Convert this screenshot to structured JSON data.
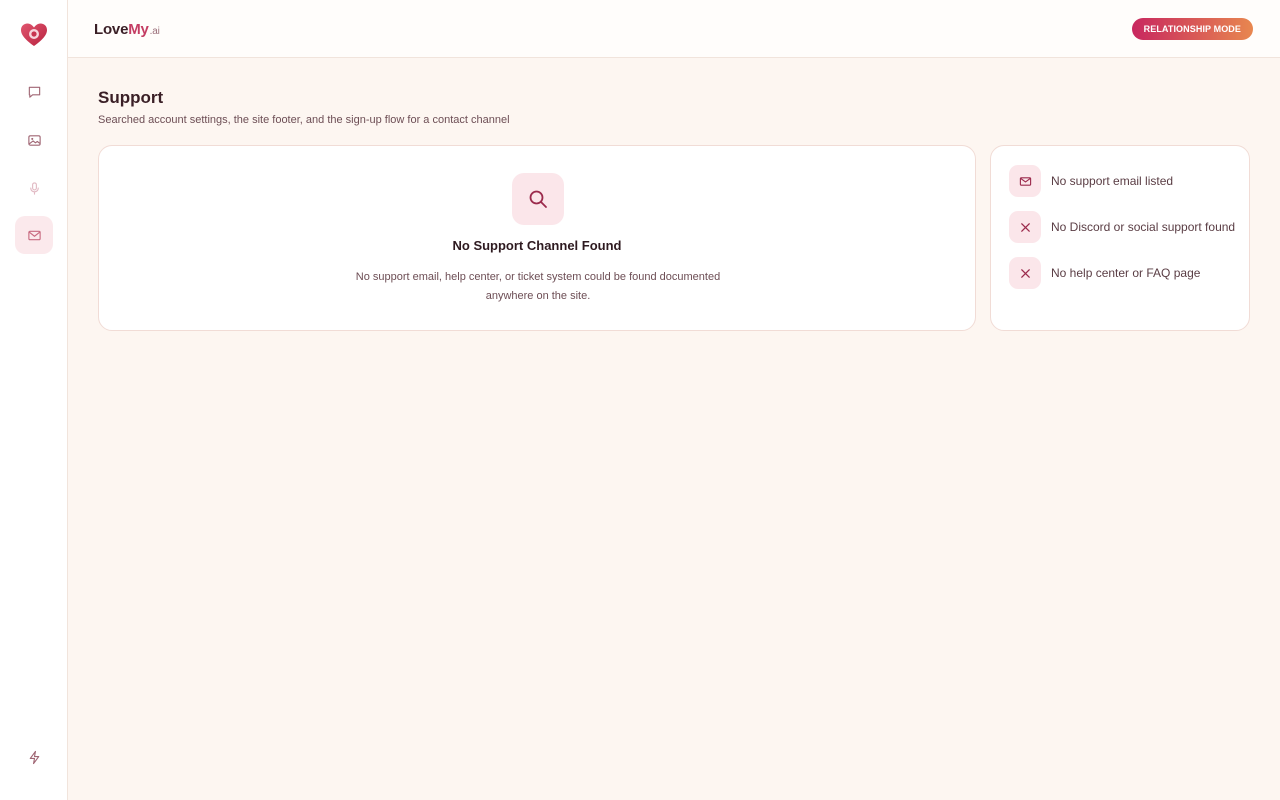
{
  "brand": {
    "part1": "Love",
    "part2": "My",
    "part3": ".ai"
  },
  "header": {
    "mode_label": "RELATIONSHIP MODE"
  },
  "sidebar": {
    "items": [
      {
        "icon": "chat-icon",
        "active": false
      },
      {
        "icon": "image-icon",
        "active": false
      },
      {
        "icon": "microphone-icon",
        "active": false
      },
      {
        "icon": "mail-icon",
        "active": true
      }
    ],
    "footer_icon": "lightning-icon"
  },
  "page": {
    "title": "Support",
    "subtitle": "Searched account settings, the site footer, and the sign-up flow for a contact channel"
  },
  "empty_state": {
    "icon": "search-icon",
    "title": "No Support Channel Found",
    "description": "No support email, help center, or ticket system could be found documented anywhere on the site."
  },
  "checks": [
    {
      "icon": "mail-icon",
      "label": "No support email listed"
    },
    {
      "icon": "x-icon",
      "label": "No Discord or social support found"
    },
    {
      "icon": "x-icon",
      "label": "No help center or FAQ page"
    }
  ],
  "colors": {
    "accent": "#c43d63",
    "page_bg": "#fdf6f1",
    "pill_gradient_start": "#c8275f",
    "pill_gradient_end": "#e8874f",
    "icon_tile_bg": "#fbe6ea"
  }
}
